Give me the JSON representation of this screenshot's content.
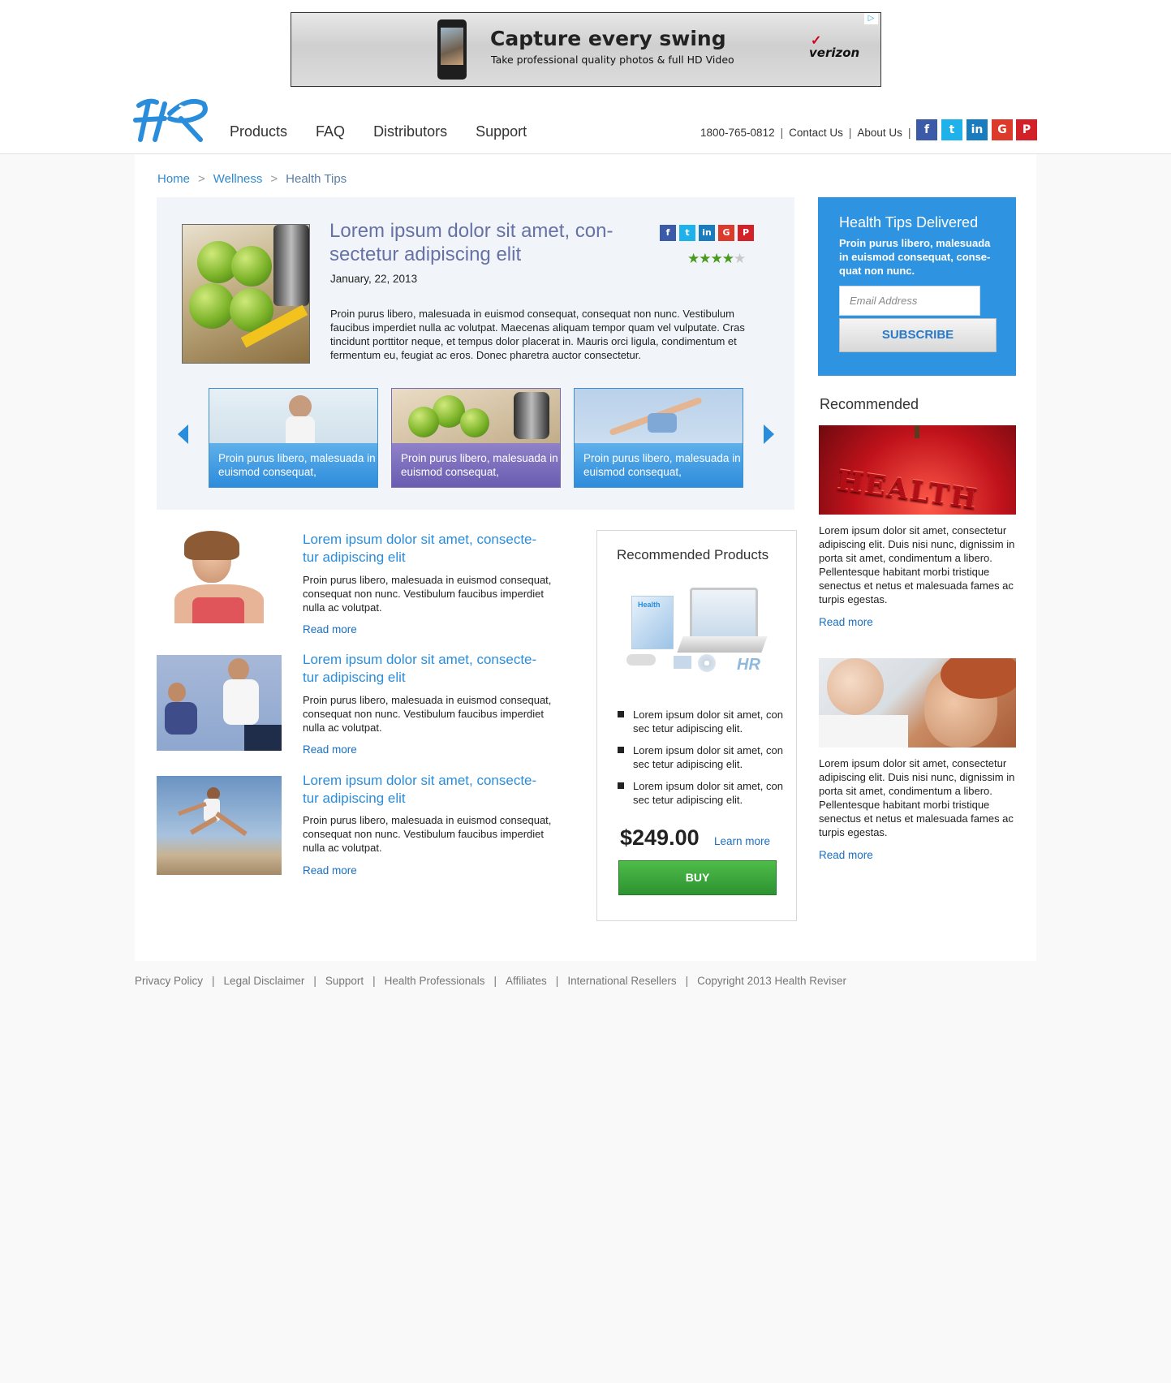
{
  "ad": {
    "headline": "Capture every swing",
    "subline": "Take professional quality photos & full HD Video",
    "brand": "verizon",
    "badge": "▷"
  },
  "logo": {
    "icon": "hr-logo-icon"
  },
  "nav": {
    "items": [
      "Products",
      "FAQ",
      "Distributors",
      "Support"
    ]
  },
  "toplinks": {
    "phone": "1800-765-0812",
    "contact": "Contact Us",
    "about": "About Us",
    "sep": "|"
  },
  "social": {
    "facebook": "f",
    "twitter": "t",
    "linkedin": "in",
    "googleplus": "G",
    "pinterest": "P"
  },
  "breadcrumb": {
    "items": [
      "Home",
      "Wellness",
      "Health Tips"
    ],
    "sep": ">"
  },
  "featured": {
    "title": "Lorem ipsum dolor sit amet, con-sectetur adipiscing elit",
    "date": "January, 22, 2013",
    "body": "Proin purus libero, malesuada in euismod consequat, consequat non nunc. Vestibulum faucibus imperdiet nulla ac volutpat. Maecenas aliquam tempor quam vel vulputate. Cras tincidunt porttitor neque, et tempus dolor placerat in. Mauris orci ligula, condimentum et fermentum eu, feugiat ac eros. Donec pharetra auctor consectetur.",
    "rating": 4,
    "rating_max": 5
  },
  "carousel": {
    "slides": [
      {
        "caption": "Proin purus libero, malesuada in euismod consequat,"
      },
      {
        "caption": "Proin purus libero, malesuada in euismod consequat,"
      },
      {
        "caption": "Proin purus libero, malesuada in euismod consequat,"
      }
    ]
  },
  "articles": [
    {
      "title": "Lorem ipsum dolor sit amet, consecte-tur adipiscing elit",
      "body": "Proin purus libero, malesuada in euismod consequat, consequat non nunc. Vestibulum faucibus imperdiet nulla ac volutpat.",
      "more": "Read more"
    },
    {
      "title": "Lorem ipsum dolor sit amet, consecte-tur adipiscing elit",
      "body": "Proin purus libero, malesuada in euismod consequat, consequat non nunc. Vestibulum faucibus imperdiet nulla ac volutpat.",
      "more": "Read more"
    },
    {
      "title": "Lorem ipsum dolor sit amet, consecte-tur adipiscing elit",
      "body": "Proin purus libero, malesuada in euismod consequat, consequat non nunc. Vestibulum faucibus imperdiet nulla ac volutpat.",
      "more": "Read more"
    }
  ],
  "products": {
    "title": "Recommended Products",
    "bullets": [
      "Lorem ipsum dolor sit amet, con sec tetur adipiscing elit.",
      "Lorem ipsum dolor sit amet, con sec tetur adipiscing elit.",
      "Lorem ipsum dolor sit amet, con sec tetur adipiscing elit."
    ],
    "price": "$249.00",
    "learn": "Learn more",
    "buy": "BUY",
    "box_label": "Health"
  },
  "newsletter": {
    "title": "Health Tips Delivered",
    "body": "Proin purus libero, malesuada in euismod consequat, conse-quat non nunc.",
    "placeholder": "Email Address",
    "button": "SUBSCRIBE"
  },
  "recommended": {
    "title": "Recommended",
    "items": [
      {
        "image_text": "HEALTH",
        "body": "Lorem ipsum dolor sit amet, consectetur adipiscing elit. Duis nisi nunc, dignissim in porta sit amet, condimentum a libero. Pellentesque habitant morbi tristique senectus et netus et malesuada fames ac turpis egestas.",
        "more": "Read more"
      },
      {
        "body": "Lorem ipsum dolor sit amet, consectetur adipiscing elit. Duis nisi nunc, dignissim in porta sit amet, condimentum a libero. Pellentesque habitant morbi tristique senectus et netus et malesuada fames ac turpis egestas.",
        "more": "Read more"
      }
    ]
  },
  "footer": {
    "links": [
      "Privacy Policy",
      "Legal Disclaimer",
      "Support",
      "Health Professionals",
      "Affiliates",
      "International Resellers",
      "Copyright 2013 Health Reviser"
    ],
    "sep": "|"
  },
  "colors": {
    "accent": "#2a8ddb",
    "newsletter_bg": "#2e93e0",
    "buy_green": "#2d9330",
    "featured_bg": "#f1f5f9"
  }
}
